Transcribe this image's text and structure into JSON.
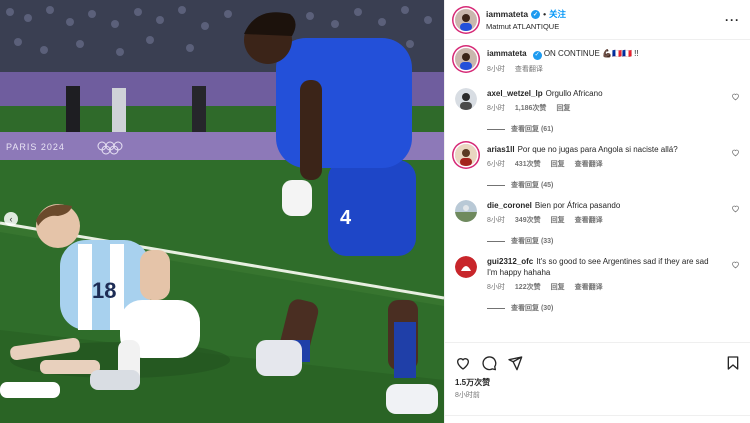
{
  "post": {
    "username": "iammateta",
    "follow_label": "关注",
    "location": "Matmut ATLANTIQUE",
    "caption_user": "iammateta",
    "caption_text": "ON CONTINUE 💪🏿🇫🇷🇫🇷 !!",
    "caption_time": "8小时",
    "caption_translate": "查看翻译",
    "likes": "1.5万次赞",
    "posted": "8小时前"
  },
  "photo": {
    "banner_text": "PARIS 2024",
    "player_left_number": "18",
    "player_right_number": "4"
  },
  "comments": [
    {
      "user": "axel_wetzel_lp",
      "text": "Orgullo Africano",
      "time": "8小时",
      "likes": "1,186次赞",
      "reply": "回复",
      "translate": "",
      "view_replies": "查看回复 (61)"
    },
    {
      "user": "arias1ll",
      "text": "Por que no jugas para Angola si naciste allá?",
      "time": "6小时",
      "likes": "431次赞",
      "reply": "回复",
      "translate": "查看翻译",
      "view_replies": "查看回复 (45)"
    },
    {
      "user": "die_coronel",
      "text": "Bien por África pasando",
      "time": "8小时",
      "likes": "349次赞",
      "reply": "回复",
      "translate": "查看翻译",
      "view_replies": "查看回复 (33)"
    },
    {
      "user": "gui2312_ofc",
      "text": "It's so good to see Argentines sad if they are sad I'm happy hahaha",
      "time": "8小时",
      "likes": "122次赞",
      "reply": "回复",
      "translate": "查看翻译",
      "view_replies": "查看回复 (30)"
    }
  ],
  "icons": {
    "like": "heart-icon",
    "comment": "comment-icon",
    "share": "share-icon",
    "save": "bookmark-icon",
    "more": "more-icon",
    "prev": "chevron-left-icon"
  },
  "colors": {
    "follow": "#0095f6",
    "verified": "#1d9bf0",
    "story_ring": "#d62976",
    "muted": "#737373"
  }
}
